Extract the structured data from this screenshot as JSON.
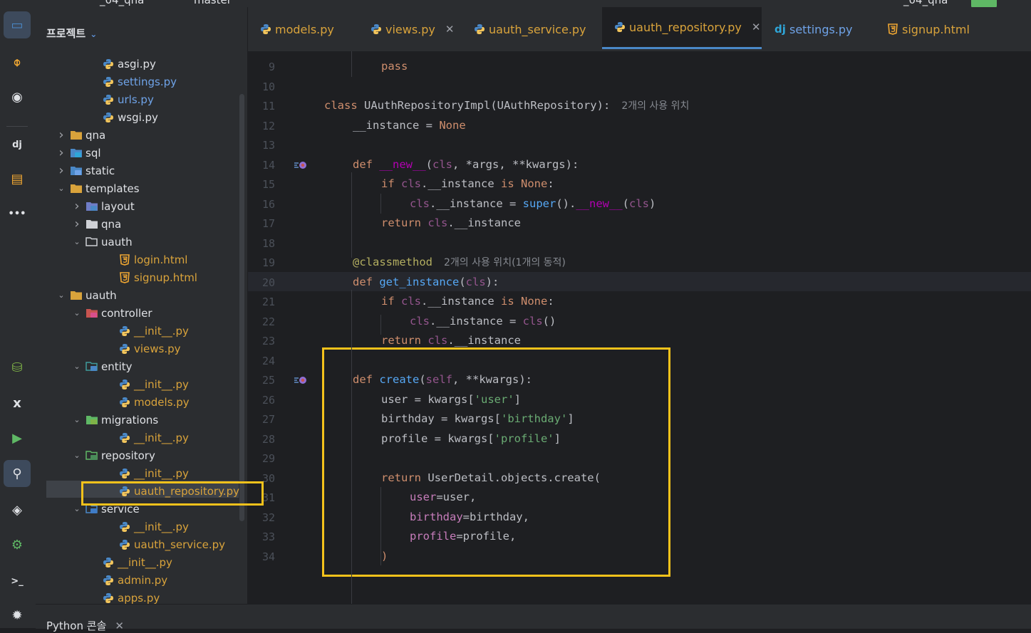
{
  "topbar": {
    "project": "_04_qna",
    "branch": "master",
    "run_config": "_04_qna"
  },
  "activity": [
    {
      "name": "project-view-icon",
      "glyph": "▭",
      "color": "#4a88c7",
      "active": true
    },
    {
      "name": "commit-icon",
      "glyph": "⌽",
      "color": "#f0a732"
    },
    {
      "name": "github-icon",
      "glyph": "◉",
      "color": "#dfe1e5"
    },
    {
      "name": "django-structure-icon",
      "glyph": "dj",
      "color": "#dfe1e5"
    },
    {
      "name": "services-icon",
      "glyph": "▤",
      "color": "#f0a732"
    },
    {
      "name": "more-icon",
      "glyph": "•••",
      "color": "#dfe1e5"
    },
    {
      "name": "database-add-icon",
      "glyph": "⛁",
      "color": "#7fb347"
    },
    {
      "name": "excel-icon",
      "glyph": "x",
      "color": "#dfe1e5"
    },
    {
      "name": "run-icon",
      "glyph": "▶",
      "color": "#5fb865"
    },
    {
      "name": "python-packages-icon",
      "glyph": "⚲",
      "color": "#dfe1e5",
      "active": true
    },
    {
      "name": "layers-icon",
      "glyph": "◈",
      "color": "#dfe1e5"
    },
    {
      "name": "settings-icon",
      "glyph": "⚙",
      "color": "#5fb865"
    },
    {
      "name": "terminal-icon",
      "glyph": ">_",
      "color": "#dfe1e5"
    },
    {
      "name": "problems-icon",
      "glyph": "✹",
      "color": "#dfe1e5"
    }
  ],
  "project_panel": {
    "title": "프로젝트",
    "tree": [
      {
        "label": "asgi.py",
        "type": "py",
        "depth": 3
      },
      {
        "label": "settings.py",
        "type": "py",
        "depth": 3,
        "color": "#6fa3e8"
      },
      {
        "label": "urls.py",
        "type": "py",
        "depth": 3,
        "color": "#6fa3e8"
      },
      {
        "label": "wsgi.py",
        "type": "py",
        "depth": 3
      },
      {
        "label": "qna",
        "type": "folder",
        "depth": 1,
        "arrow": "closed"
      },
      {
        "label": "sql",
        "type": "folder-sql",
        "depth": 1,
        "arrow": "closed"
      },
      {
        "label": "static",
        "type": "folder-static",
        "depth": 1,
        "arrow": "closed"
      },
      {
        "label": "templates",
        "type": "folder",
        "depth": 1,
        "arrow": "open"
      },
      {
        "label": "layout",
        "type": "folder-layout",
        "depth": 2,
        "arrow": "closed"
      },
      {
        "label": "qna",
        "type": "folder-plain",
        "depth": 2,
        "arrow": "closed"
      },
      {
        "label": "uauth",
        "type": "folder-open-plain",
        "depth": 2,
        "arrow": "open"
      },
      {
        "label": "login.html",
        "type": "html",
        "depth": 4,
        "color": "#d9a33b"
      },
      {
        "label": "signup.html",
        "type": "html",
        "depth": 4,
        "color": "#d9a33b"
      },
      {
        "label": "uauth",
        "type": "folder",
        "depth": 1,
        "arrow": "open"
      },
      {
        "label": "controller",
        "type": "folder-controller",
        "depth": 2,
        "arrow": "open"
      },
      {
        "label": "__init__.py",
        "type": "py",
        "depth": 4,
        "color": "#d9a33b"
      },
      {
        "label": "views.py",
        "type": "py",
        "depth": 4,
        "color": "#d9a33b"
      },
      {
        "label": "entity",
        "type": "folder-entity",
        "depth": 2,
        "arrow": "open"
      },
      {
        "label": "__init__.py",
        "type": "py",
        "depth": 4,
        "color": "#d9a33b"
      },
      {
        "label": "models.py",
        "type": "py",
        "depth": 4,
        "color": "#d9a33b"
      },
      {
        "label": "migrations",
        "type": "folder-migrations",
        "depth": 2,
        "arrow": "open"
      },
      {
        "label": "__init__.py",
        "type": "py",
        "depth": 4,
        "color": "#d9a33b"
      },
      {
        "label": "repository",
        "type": "folder-repository",
        "depth": 2,
        "arrow": "open"
      },
      {
        "label": "__init__.py",
        "type": "py",
        "depth": 4,
        "color": "#d9a33b"
      },
      {
        "label": "uauth_repository.py",
        "type": "py",
        "depth": 4,
        "color": "#d9a33b",
        "selected": true
      },
      {
        "label": "service",
        "type": "folder-service",
        "depth": 2,
        "arrow": "open"
      },
      {
        "label": "__init__.py",
        "type": "py",
        "depth": 4,
        "color": "#d9a33b"
      },
      {
        "label": "uauth_service.py",
        "type": "py",
        "depth": 4,
        "color": "#d9a33b"
      },
      {
        "label": "__init__.py",
        "type": "py",
        "depth": 3,
        "color": "#d9a33b"
      },
      {
        "label": "admin.py",
        "type": "py",
        "depth": 3,
        "color": "#d9a33b"
      },
      {
        "label": "apps.py",
        "type": "py",
        "depth": 3,
        "color": "#d9a33b"
      }
    ]
  },
  "tabs": [
    {
      "label": "models.py",
      "icon": "py",
      "color": "#d9a33b",
      "closable": false
    },
    {
      "label": "views.py",
      "icon": "py",
      "color": "#d9a33b",
      "closable": true
    },
    {
      "label": "uauth_service.py",
      "icon": "py",
      "color": "#d9a33b",
      "closable": false
    },
    {
      "label": "uauth_repository.py",
      "icon": "py",
      "color": "#d9a33b",
      "closable": true,
      "active": true
    },
    {
      "label": "settings.py",
      "icon": "dj",
      "color": "#6fa3e8",
      "closable": false
    },
    {
      "label": "signup.html",
      "icon": "html",
      "color": "#d9a33b",
      "closable": false
    }
  ],
  "editor": {
    "lines": [
      {
        "n": "9",
        "indent": 2,
        "tokens": [
          [
            "pass",
            "kw"
          ]
        ]
      },
      {
        "n": "10",
        "indent": 0,
        "tokens": []
      },
      {
        "n": "11",
        "indent": 0,
        "tokens": [
          [
            "class ",
            "kw"
          ],
          [
            "UAuthRepositoryImpl",
            "pl"
          ],
          [
            "(",
            "pl"
          ],
          [
            "UAuthRepository",
            "pl"
          ],
          [
            "):",
            "pl"
          ]
        ],
        "hint": "2개의 사용 위치"
      },
      {
        "n": "12",
        "indent": 1,
        "tokens": [
          [
            "__instance",
            "pl"
          ],
          [
            " = ",
            "pl"
          ],
          [
            "None",
            "kw"
          ]
        ]
      },
      {
        "n": "13",
        "indent": 0,
        "tokens": []
      },
      {
        "n": "14",
        "indent": 1,
        "tokens": [
          [
            "def ",
            "kw"
          ],
          [
            "__new__",
            "magic"
          ],
          [
            "(",
            "pl"
          ],
          [
            "cls",
            "self"
          ],
          [
            ", *args, **kwargs):",
            "pl"
          ]
        ],
        "gutter_icon": true
      },
      {
        "n": "15",
        "indent": 2,
        "tokens": [
          [
            "if ",
            "kw"
          ],
          [
            "cls",
            "self"
          ],
          [
            ".__instance ",
            "pl"
          ],
          [
            "is ",
            "kw"
          ],
          [
            "None",
            "kw"
          ],
          [
            ":",
            "pl"
          ]
        ]
      },
      {
        "n": "16",
        "indent": 3,
        "tokens": [
          [
            "cls",
            "self"
          ],
          [
            ".__instance = ",
            "pl"
          ],
          [
            "super",
            "fn"
          ],
          [
            "().",
            "pl"
          ],
          [
            "__new__",
            "magic"
          ],
          [
            "(",
            "pl"
          ],
          [
            "cls",
            "self"
          ],
          [
            ")",
            "pl"
          ]
        ]
      },
      {
        "n": "17",
        "indent": 2,
        "tokens": [
          [
            "return ",
            "kw"
          ],
          [
            "cls",
            "self"
          ],
          [
            ".__instance",
            "pl"
          ]
        ]
      },
      {
        "n": "18",
        "indent": 0,
        "tokens": []
      },
      {
        "n": "19",
        "indent": 1,
        "tokens": [
          [
            "@classmethod",
            "dec"
          ]
        ],
        "hint": "2개의 사용 위치(1개의 동적)"
      },
      {
        "n": "20",
        "indent": 1,
        "tokens": [
          [
            "def ",
            "kw"
          ],
          [
            "get_instance",
            "fn"
          ],
          [
            "(",
            "pl"
          ],
          [
            "cls",
            "self"
          ],
          [
            "):",
            "pl"
          ]
        ],
        "current": true
      },
      {
        "n": "21",
        "indent": 2,
        "tokens": [
          [
            "if ",
            "kw"
          ],
          [
            "cls",
            "self"
          ],
          [
            ".__instance ",
            "pl"
          ],
          [
            "is ",
            "kw"
          ],
          [
            "None",
            "kw"
          ],
          [
            ":",
            "pl"
          ]
        ]
      },
      {
        "n": "22",
        "indent": 3,
        "tokens": [
          [
            "cls",
            "self"
          ],
          [
            ".__instance = ",
            "pl"
          ],
          [
            "cls",
            "self"
          ],
          [
            "()",
            "pl"
          ]
        ]
      },
      {
        "n": "23",
        "indent": 2,
        "tokens": [
          [
            "return ",
            "kw"
          ],
          [
            "cls",
            "self"
          ],
          [
            ".__instance",
            "pl"
          ]
        ]
      },
      {
        "n": "24",
        "indent": 0,
        "tokens": []
      },
      {
        "n": "25",
        "indent": 1,
        "tokens": [
          [
            "def ",
            "kw"
          ],
          [
            "create",
            "fn"
          ],
          [
            "(",
            "pl"
          ],
          [
            "self",
            "self"
          ],
          [
            ", **kwargs):",
            "pl"
          ]
        ],
        "gutter_icon": true
      },
      {
        "n": "26",
        "indent": 2,
        "tokens": [
          [
            "user = kwargs[",
            "pl"
          ],
          [
            "'user'",
            "str"
          ],
          [
            "]",
            "pl"
          ]
        ]
      },
      {
        "n": "27",
        "indent": 2,
        "tokens": [
          [
            "birthday = kwargs[",
            "pl"
          ],
          [
            "'birthday'",
            "str"
          ],
          [
            "]",
            "pl"
          ]
        ]
      },
      {
        "n": "28",
        "indent": 2,
        "tokens": [
          [
            "profile = kwargs[",
            "pl"
          ],
          [
            "'profile'",
            "str"
          ],
          [
            "]",
            "pl"
          ]
        ]
      },
      {
        "n": "29",
        "indent": 0,
        "tokens": []
      },
      {
        "n": "30",
        "indent": 2,
        "tokens": [
          [
            "return ",
            "kw"
          ],
          [
            "UserDetail.objects.create(",
            "pl"
          ]
        ]
      },
      {
        "n": "31",
        "indent": 3,
        "tokens": [
          [
            "user",
            "param"
          ],
          [
            "=user,",
            "pl"
          ]
        ]
      },
      {
        "n": "32",
        "indent": 3,
        "tokens": [
          [
            "birthday",
            "param"
          ],
          [
            "=birthday,",
            "pl"
          ]
        ]
      },
      {
        "n": "33",
        "indent": 3,
        "tokens": [
          [
            "profile",
            "param"
          ],
          [
            "=profile,",
            "pl"
          ]
        ]
      },
      {
        "n": "34",
        "indent": 2,
        "tokens": [
          [
            ")",
            "kw"
          ]
        ]
      }
    ]
  },
  "bottom": {
    "tab_label": "Python 콘솔"
  },
  "colors": {
    "accent": "#4a88c7",
    "highlight_box": "#f4c21b",
    "keyword": "#cf8e6d",
    "string": "#6aab73",
    "function": "#56a8f5",
    "self": "#94558d",
    "magic": "#b200b2",
    "decorator": "#b3ae60",
    "param": "#c77dbb"
  }
}
